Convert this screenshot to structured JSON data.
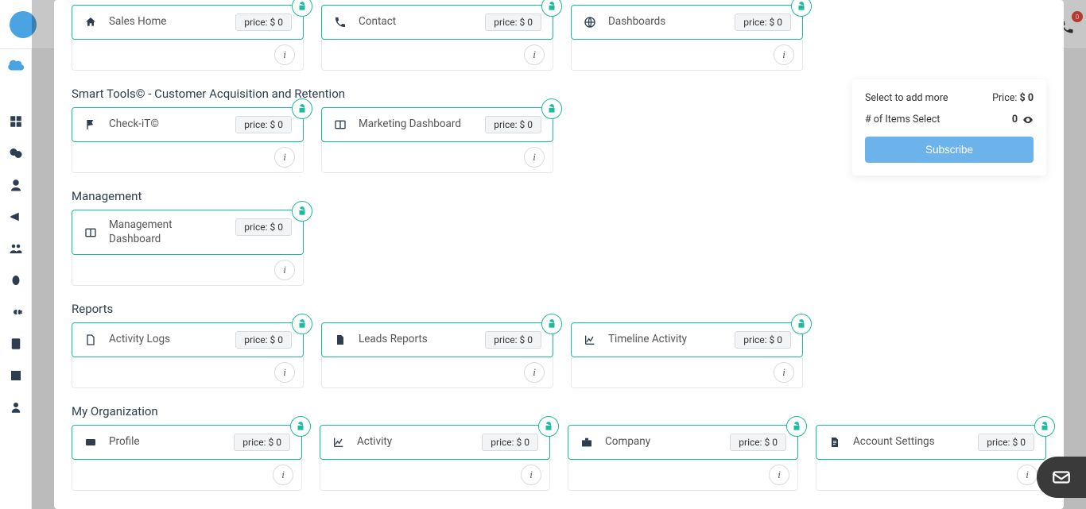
{
  "topbar": {
    "notification_count": "0"
  },
  "summary": {
    "select_label": "Select to add more",
    "price_label": "Price:",
    "price_value": "$ 0",
    "items_label": "# of Items Select",
    "items_value": "0",
    "subscribe_label": "Subscribe"
  },
  "price_prefix": "price: ",
  "sections": [
    {
      "title": "",
      "cards": [
        {
          "icon": "home",
          "title": "Sales Home",
          "price": "$ 0"
        },
        {
          "icon": "phone",
          "title": "Contact",
          "price": "$ 0"
        },
        {
          "icon": "globe",
          "title": "Dashboards",
          "price": "$ 0"
        }
      ]
    },
    {
      "title": "Smart Tools© - Customer Acquisition and Retention",
      "cards": [
        {
          "icon": "flag",
          "title": "Check-iT©",
          "price": "$ 0"
        },
        {
          "icon": "columns",
          "title": "Marketing Dashboard",
          "price": "$ 0"
        }
      ]
    },
    {
      "title": "Management",
      "cards": [
        {
          "icon": "columns",
          "title": "Management Dashboard",
          "price": "$ 0"
        }
      ]
    },
    {
      "title": "Reports",
      "cards": [
        {
          "icon": "file",
          "title": "Activity Logs",
          "price": "$ 0"
        },
        {
          "icon": "file-solid",
          "title": "Leads Reports",
          "price": "$ 0"
        },
        {
          "icon": "chart",
          "title": "Timeline Activity",
          "price": "$ 0"
        }
      ]
    },
    {
      "title": "My Organization",
      "cards": [
        {
          "icon": "id-card",
          "title": "Profile",
          "price": "$ 0"
        },
        {
          "icon": "chart",
          "title": "Activity",
          "price": "$ 0"
        },
        {
          "icon": "briefcase",
          "title": "Company",
          "price": "$ 0"
        },
        {
          "icon": "file-lines",
          "title": "Account Settings",
          "price": "$ 0"
        }
      ]
    }
  ]
}
